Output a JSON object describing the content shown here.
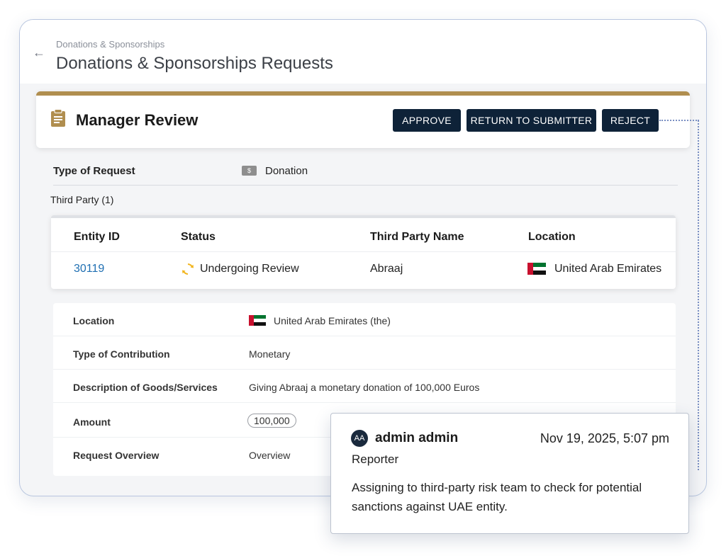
{
  "header": {
    "breadcrumb": "Donations & Sponsorships",
    "title": "Donations & Sponsorships Requests"
  },
  "review": {
    "title": "Manager Review",
    "buttons": {
      "approve": "APPROVE",
      "return": "RETURN TO SUBMITTER",
      "reject": "REJECT"
    },
    "accent_color": "#b08e4f",
    "button_color": "#0e2238"
  },
  "request": {
    "type_label": "Type of Request",
    "type_icon": "$",
    "type_value": "Donation"
  },
  "third_party": {
    "heading": "Third Party (1)",
    "columns": [
      "Entity ID",
      "Status",
      "Third Party Name",
      "Location"
    ],
    "row": {
      "entity_id": "30119",
      "status": "Undergoing Review",
      "name": "Abraaj",
      "location": "United Arab Emirates"
    }
  },
  "details": {
    "rows": [
      {
        "label": "Location",
        "value": "United Arab Emirates (the)"
      },
      {
        "label": "Type of Contribution",
        "value": "Monetary"
      },
      {
        "label": "Description of Goods/Services",
        "value": "Giving Abraaj a monetary donation of 100,000 Euros"
      },
      {
        "label": "Amount",
        "value": "100,000"
      },
      {
        "label": "Request Overview",
        "value": "Overview"
      }
    ]
  },
  "comment": {
    "avatar_initials": "AA",
    "author": "admin admin",
    "date": "Nov 19, 2025, 5:07 pm",
    "role": "Reporter",
    "body": "Assigning to third-party risk team to check for potential sanctions against UAE entity."
  }
}
